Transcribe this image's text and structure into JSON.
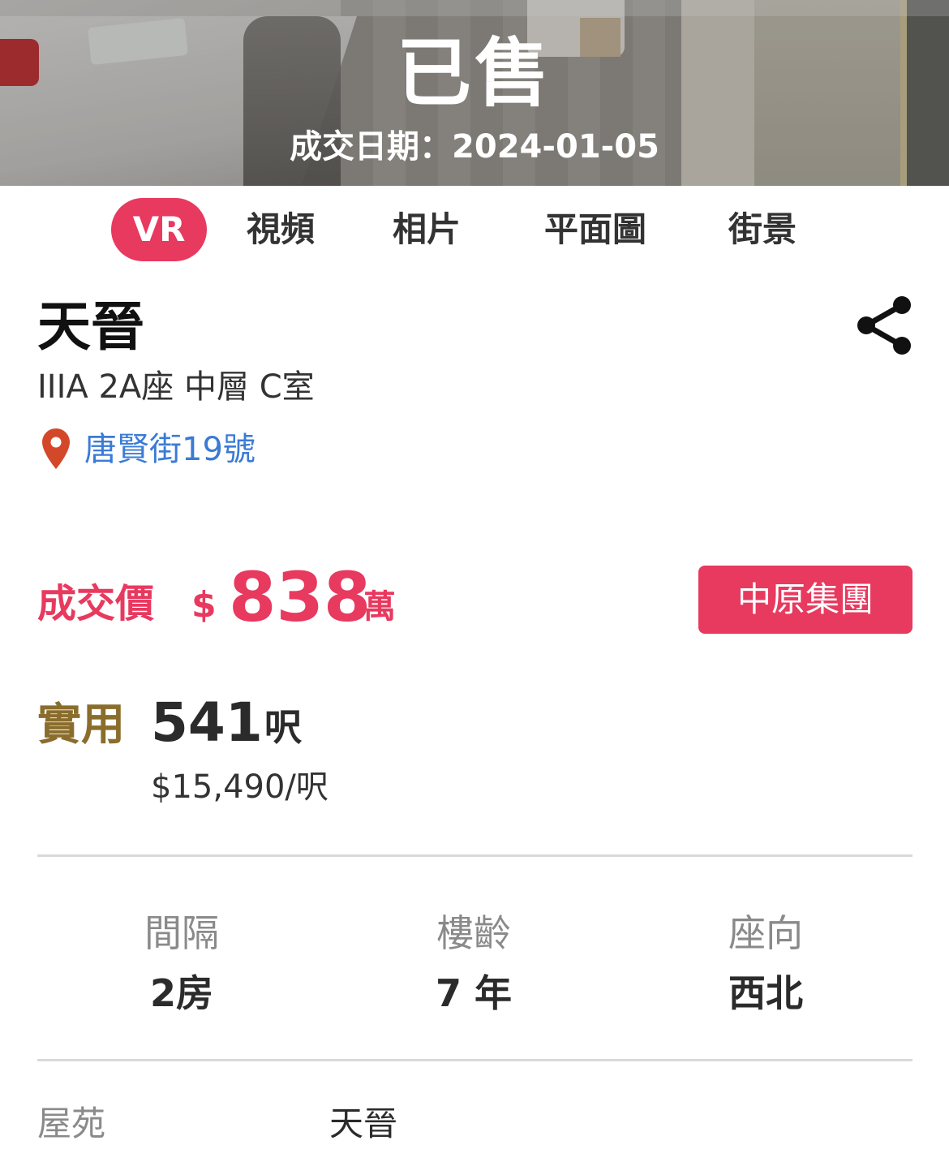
{
  "hero": {
    "status": "已售",
    "deal_date": "成交日期：2024-01-05"
  },
  "media_tabs": [
    {
      "label": "VR",
      "active": true
    },
    {
      "label": "視頻",
      "active": false
    },
    {
      "label": "相片",
      "active": false
    },
    {
      "label": "平面圖",
      "active": false
    },
    {
      "label": "街景",
      "active": false
    }
  ],
  "property": {
    "name": "天晉",
    "unit": "IIIA 2A座 中層 C室",
    "address": "唐賢街19號",
    "share_icon": "share-icon",
    "pin_icon": "location-pin-icon"
  },
  "price": {
    "label": "成交價",
    "currency": "$",
    "value": "838",
    "unit": "萬",
    "agency": "中原集團"
  },
  "area": {
    "label": "實用",
    "value": "541",
    "unit": "呎",
    "price_per_sqft": "$15,490/呎"
  },
  "stats": [
    {
      "label": "間隔",
      "value": "2房"
    },
    {
      "label": "樓齡",
      "value": "7 年"
    },
    {
      "label": "座向",
      "value": "西北"
    }
  ],
  "details": [
    {
      "label": "屋苑",
      "value": "天晉"
    }
  ],
  "colors": {
    "accent": "#e8395f",
    "area_label": "#8a6d2c",
    "link": "#3a7bd5",
    "pin": "#d4482a"
  }
}
